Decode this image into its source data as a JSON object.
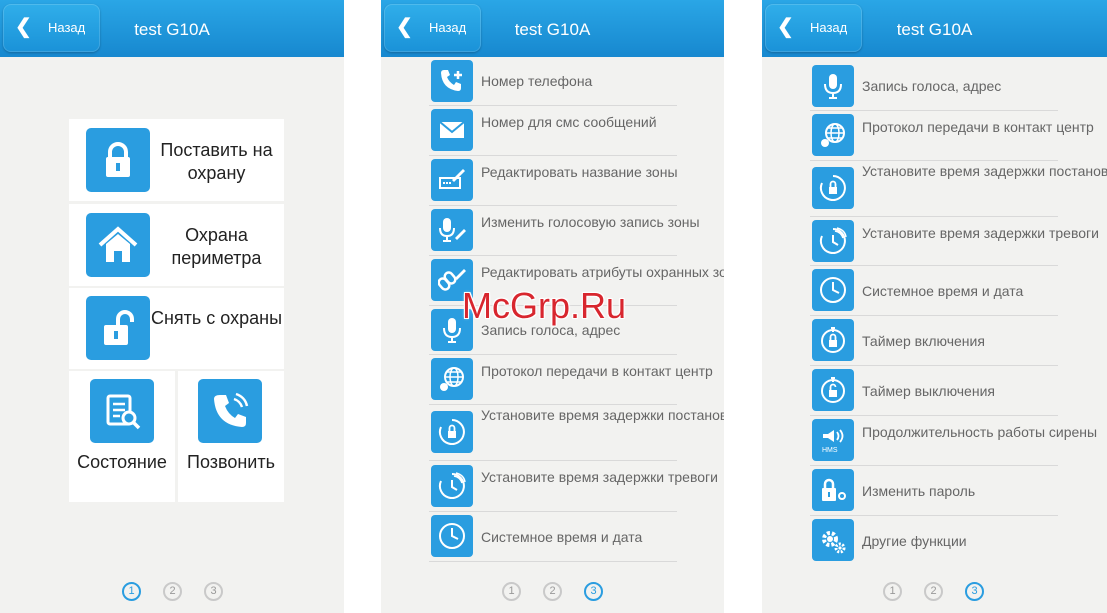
{
  "screens": [
    {
      "back_label": "Назад",
      "title": "test G10A",
      "tiles": [
        {
          "label": "Поставить на охрану",
          "icon": "lock-icon"
        },
        {
          "label": "Охрана периметра",
          "icon": "home-icon"
        },
        {
          "label": "Снять с охраны",
          "icon": "unlock-icon"
        },
        {
          "label": "Состояние",
          "icon": "status-report-icon"
        },
        {
          "label": "Позвонить",
          "icon": "phone-call-icon"
        }
      ],
      "pages": [
        "1",
        "2",
        "3"
      ],
      "active_page": "1"
    },
    {
      "back_label": "Назад",
      "title": "test G10A",
      "items": [
        {
          "label": "Номер телефона",
          "icon": "phone-add-icon"
        },
        {
          "label": "Номер для смс сообщений",
          "icon": "envelope-icon"
        },
        {
          "label": "Редактировать название зоны",
          "icon": "edit-name-icon"
        },
        {
          "label": "Изменить голосовую запись зоны",
          "icon": "mic-edit-icon"
        },
        {
          "label": "Редактировать атрибуты охранных зон",
          "icon": "link-edit-icon"
        },
        {
          "label": "Запись голоса, адрес",
          "icon": "microphone-icon"
        },
        {
          "label": "Протокол передачи в контакт центр",
          "icon": "globe-icon"
        },
        {
          "label": "Установите время задержки постановки на охрану",
          "icon": "arm-delay-icon"
        },
        {
          "label": "Установите время задержки тревоги",
          "icon": "alarm-delay-icon"
        },
        {
          "label": "Системное время и дата",
          "icon": "clock-icon"
        }
      ],
      "pages": [
        "1",
        "2",
        "3"
      ],
      "active_page": "3"
    },
    {
      "back_label": "Назад",
      "title": "test G10A",
      "items": [
        {
          "label": "Запись голоса, адрес",
          "icon": "microphone-icon"
        },
        {
          "label": "Протокол передачи в контакт центр",
          "icon": "globe-icon"
        },
        {
          "label": "Установите время задержки постановки на охрану",
          "icon": "arm-delay-icon"
        },
        {
          "label": "Установите время задержки тревоги",
          "icon": "alarm-delay-icon"
        },
        {
          "label": "Системное время и дата",
          "icon": "clock-icon"
        },
        {
          "label": "Таймер включения",
          "icon": "timer-on-icon"
        },
        {
          "label": "Таймер выключения",
          "icon": "timer-off-icon"
        },
        {
          "label": "Продолжительность работы сирены",
          "icon": "siren-icon"
        },
        {
          "label": "Изменить пароль",
          "icon": "password-icon"
        },
        {
          "label": "Другие функции",
          "icon": "gears-icon"
        }
      ],
      "pages": [
        "1",
        "2",
        "3"
      ],
      "active_page": "3"
    }
  ],
  "watermark": "McGrp.Ru",
  "accent_color": "#2a9de0",
  "header_color": "#1e95dc"
}
